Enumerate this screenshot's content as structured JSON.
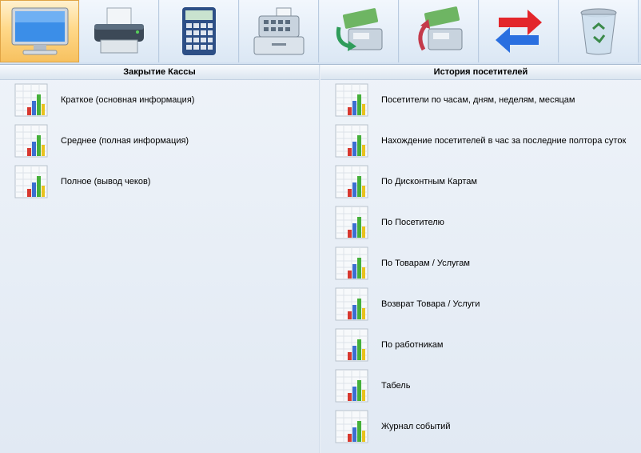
{
  "toolbar": {
    "buttons": [
      {
        "icon": "monitor-icon",
        "active": true
      },
      {
        "icon": "printer-icon",
        "active": false
      },
      {
        "icon": "calculator-icon",
        "active": false
      },
      {
        "icon": "cash-register-icon",
        "active": false
      },
      {
        "icon": "cash-in-icon",
        "active": false
      },
      {
        "icon": "cash-out-icon",
        "active": false
      },
      {
        "icon": "exchange-arrows-icon",
        "active": false
      },
      {
        "icon": "recycle-bin-icon",
        "active": false
      }
    ]
  },
  "left_panel": {
    "title": "Закрытие Кассы",
    "items": [
      {
        "label": "Краткое (основная информация)",
        "icon": "report-chart-icon"
      },
      {
        "label": "Среднее (полная информация)",
        "icon": "report-chart-icon"
      },
      {
        "label": "Полное (вывод чеков)",
        "icon": "report-chart-icon"
      }
    ]
  },
  "right_panel": {
    "title": "История посетителей",
    "items": [
      {
        "label": "Посетители по часам, дням, неделям, месяцам",
        "icon": "report-chart-icon"
      },
      {
        "label": "Нахождение посетителей в час за последние полтора суток",
        "icon": "report-chart-icon"
      },
      {
        "label": "По Дисконтным Картам",
        "icon": "report-chart-icon"
      },
      {
        "label": "По Посетителю",
        "icon": "report-chart-icon"
      },
      {
        "label": "По Товарам / Услугам",
        "icon": "report-chart-icon"
      },
      {
        "label": "Возврат Товара / Услуги",
        "icon": "report-chart-icon"
      },
      {
        "label": "По работникам",
        "icon": "report-chart-icon"
      },
      {
        "label": "Табель",
        "icon": "report-chart-icon"
      },
      {
        "label": "Журнал событий",
        "icon": "report-chart-icon"
      }
    ]
  },
  "colors": {
    "background": "#e6edf6",
    "active_tab": "#ffd98a",
    "bar_red": "#d8382f",
    "bar_blue": "#3b6fd1",
    "bar_green": "#45b03a",
    "bar_yellow": "#e9c21c"
  }
}
